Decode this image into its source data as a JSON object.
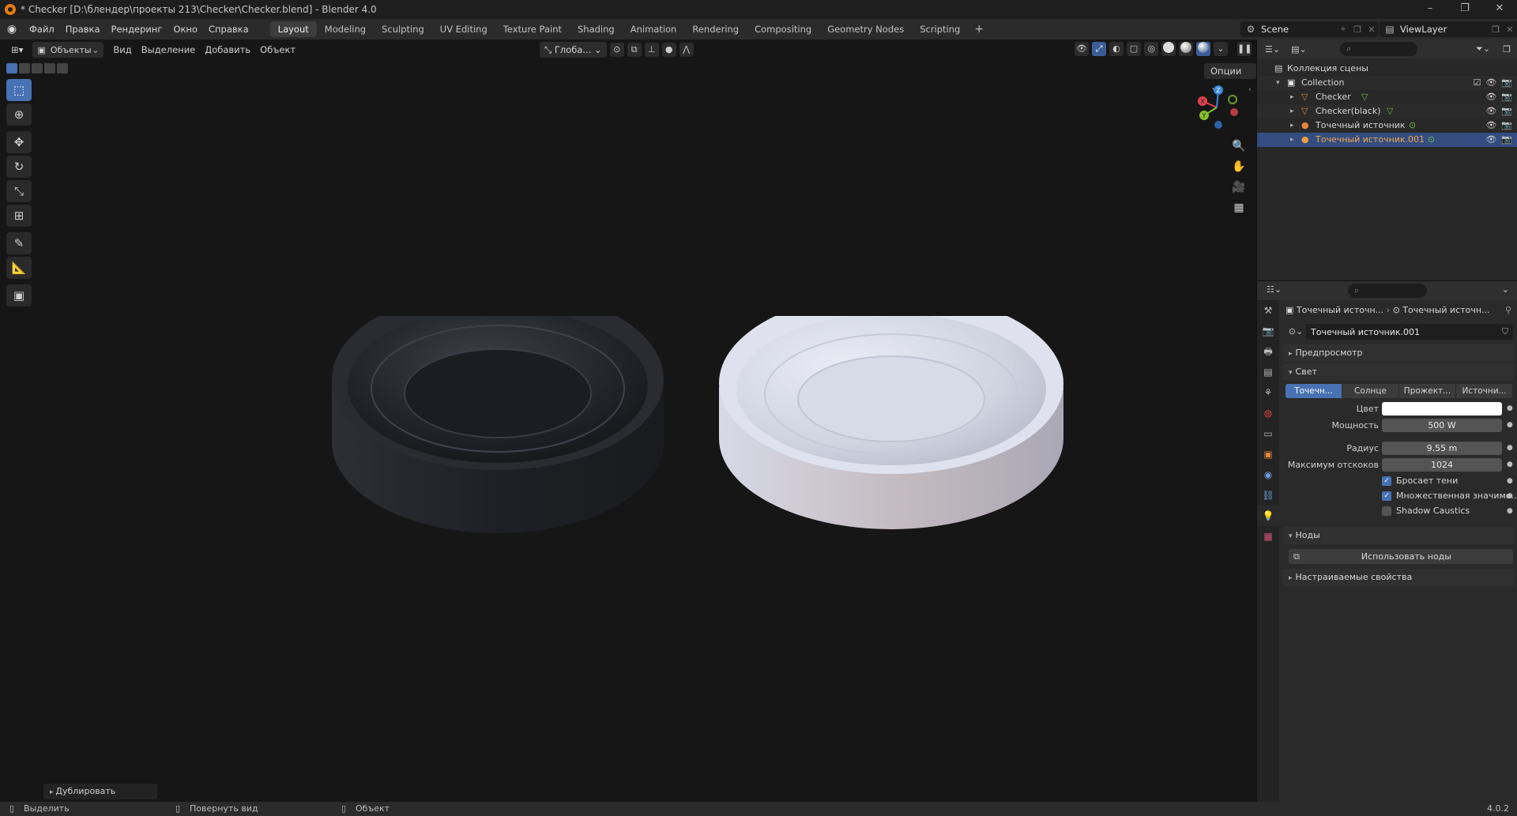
{
  "window": {
    "title": "* Checker [D:\\блендер\\проекты 213\\Checker\\Checker.blend] - Blender 4.0",
    "controls": [
      "–",
      "❐",
      "✕"
    ]
  },
  "menubar": {
    "menus": [
      "Файл",
      "Правка",
      "Рендеринг",
      "Окно",
      "Справка"
    ],
    "workspaces": [
      "Layout",
      "Modeling",
      "Sculpting",
      "UV Editing",
      "Texture Paint",
      "Shading",
      "Animation",
      "Rendering",
      "Compositing",
      "Geometry Nodes",
      "Scripting"
    ],
    "active_workspace": "Layout",
    "scene": "Scene",
    "view_layer": "ViewLayer"
  },
  "viewport": {
    "mode": "Объекты",
    "menus": [
      "Вид",
      "Выделение",
      "Добавить",
      "Объект"
    ],
    "orientation": "Глоба...",
    "options": "Опции",
    "last_operator": "Дублировать",
    "gizmo_axes": [
      "X",
      "Y",
      "Z"
    ],
    "colors": {
      "x_axis": "#e0424e",
      "y_axis": "#83c12e",
      "z_axis": "#3a88d8"
    }
  },
  "outliner": {
    "scene_collection": "Коллекция сцены",
    "rows": [
      {
        "label": "Collection",
        "type": "collection"
      },
      {
        "label": "Checker",
        "type": "mesh"
      },
      {
        "label": "Checker(black)",
        "type": "mesh"
      },
      {
        "label": "Точечный источник",
        "type": "light"
      },
      {
        "label": "Точечный источник.001",
        "type": "light",
        "selected": true
      }
    ]
  },
  "properties": {
    "breadcrumb_object": "Точечный источн...",
    "breadcrumb_data": "Точечный источн...",
    "datablock_name": "Точечный источник.001",
    "panels": {
      "preview": "Предпросмотр",
      "light": "Свет",
      "nodes": "Ноды",
      "custom_props": "Настраиваемые свойства"
    },
    "light_types": [
      "Точечн...",
      "Солнце",
      "Прожект...",
      "Источни..."
    ],
    "active_light_type": "Точечн...",
    "fields": {
      "color_label": "Цвет",
      "power_label": "Мощность",
      "power_value": "500 W",
      "radius_label": "Радиус",
      "radius_value": "9.55 m",
      "bounces_label": "Максимум отскоков",
      "bounces_value": "1024"
    },
    "checkboxes": [
      {
        "label": "Бросает тени",
        "checked": true
      },
      {
        "label": "Множественная значимо...",
        "checked": true
      },
      {
        "label": "Shadow Caustics",
        "checked": false
      }
    ],
    "use_nodes": "Использовать ноды"
  },
  "statusbar": {
    "select": "Выделить",
    "rotate": "Повернуть вид",
    "object": "Объект",
    "version": "4.0.2"
  }
}
